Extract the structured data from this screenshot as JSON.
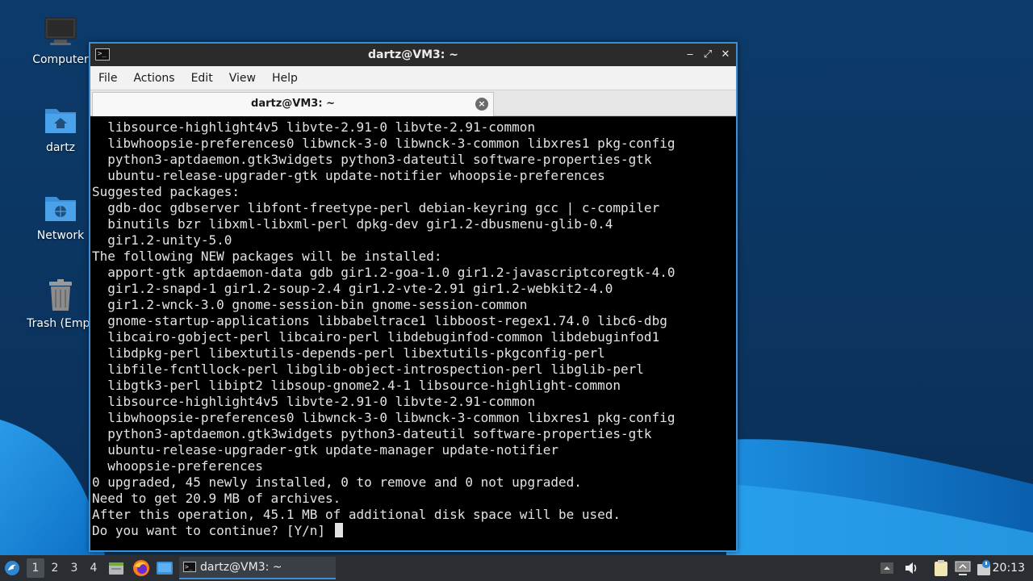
{
  "desktop": {
    "icons": [
      {
        "label": "Computer",
        "icon": "computer-icon"
      },
      {
        "label": "dartz",
        "icon": "home-folder-icon"
      },
      {
        "label": "Network",
        "icon": "network-folder-icon"
      },
      {
        "label": "Trash (Empt",
        "icon": "trash-icon"
      }
    ]
  },
  "window": {
    "title": "dartz@VM3: ~",
    "buttons": {
      "minimize": "‒",
      "maximize": "⤢",
      "close": "✕"
    },
    "menu": [
      "File",
      "Actions",
      "Edit",
      "View",
      "Help"
    ],
    "tab": {
      "label": "dartz@VM3: ~",
      "close": "×"
    },
    "terminal_lines": [
      "  libsource-highlight4v5 libvte-2.91-0 libvte-2.91-common",
      "  libwhoopsie-preferences0 libwnck-3-0 libwnck-3-common libxres1 pkg-config",
      "  python3-aptdaemon.gtk3widgets python3-dateutil software-properties-gtk",
      "  ubuntu-release-upgrader-gtk update-notifier whoopsie-preferences",
      "Suggested packages:",
      "  gdb-doc gdbserver libfont-freetype-perl debian-keyring gcc | c-compiler",
      "  binutils bzr libxml-libxml-perl dpkg-dev gir1.2-dbusmenu-glib-0.4",
      "  gir1.2-unity-5.0",
      "The following NEW packages will be installed:",
      "  apport-gtk aptdaemon-data gdb gir1.2-goa-1.0 gir1.2-javascriptcoregtk-4.0",
      "  gir1.2-snapd-1 gir1.2-soup-2.4 gir1.2-vte-2.91 gir1.2-webkit2-4.0",
      "  gir1.2-wnck-3.0 gnome-session-bin gnome-session-common",
      "  gnome-startup-applications libbabeltrace1 libboost-regex1.74.0 libc6-dbg",
      "  libcairo-gobject-perl libcairo-perl libdebuginfod-common libdebuginfod1",
      "  libdpkg-perl libextutils-depends-perl libextutils-pkgconfig-perl",
      "  libfile-fcntllock-perl libglib-object-introspection-perl libglib-perl",
      "  libgtk3-perl libipt2 libsoup-gnome2.4-1 libsource-highlight-common",
      "  libsource-highlight4v5 libvte-2.91-0 libvte-2.91-common",
      "  libwhoopsie-preferences0 libwnck-3-0 libwnck-3-common libxres1 pkg-config",
      "  python3-aptdaemon.gtk3widgets python3-dateutil software-properties-gtk",
      "  ubuntu-release-upgrader-gtk update-manager update-notifier",
      "  whoopsie-preferences",
      "0 upgraded, 45 newly installed, 0 to remove and 0 not upgraded.",
      "Need to get 20.9 MB of archives.",
      "After this operation, 45.1 MB of additional disk space will be used."
    ],
    "prompt": "Do you want to continue? [Y/n] "
  },
  "taskbar": {
    "workspaces": [
      "1",
      "2",
      "3",
      "4"
    ],
    "active_workspace": "1",
    "task": "dartz@VM3: ~",
    "clock": "20:13"
  },
  "colors": {
    "accent": "#3d8fd6",
    "desktop": "#0f3a66",
    "terminal_bg": "#000000",
    "terminal_fg": "#e3e3e3"
  }
}
